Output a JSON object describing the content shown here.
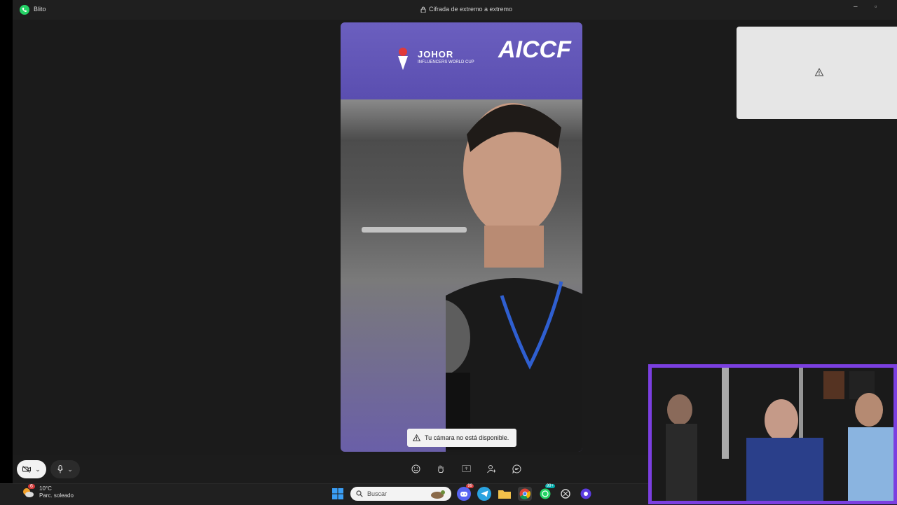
{
  "window": {
    "app_name": "Blito",
    "encryption_label": "Cifrada de extremo a extremo",
    "minimize_glyph": "–",
    "restore_glyph": "▫"
  },
  "banner": {
    "event_name": "JOHOR",
    "event_subtitle": "INFLUENCERS WORLD CUP",
    "sponsor": "AICCF"
  },
  "call": {
    "camera_warning": "Tu cámara no está disponible."
  },
  "controls": {
    "camera_chevron": "⌄",
    "mic_chevron": "⌄"
  },
  "taskbar": {
    "weather_temp": "10°C",
    "weather_desc": "Parc. soleado",
    "weather_badge": "6",
    "search_placeholder": "Buscar",
    "whatsapp_badge": "99+",
    "discord_badge": "99"
  },
  "colors": {
    "accent_whatsapp": "#25D366",
    "webcam_border": "#7b3fe0",
    "banner_purple": "#5a4eb0"
  }
}
